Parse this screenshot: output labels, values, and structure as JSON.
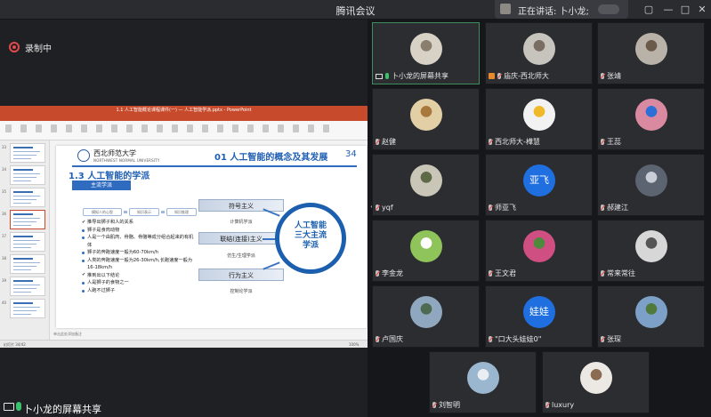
{
  "window": {
    "title": "腾讯会议",
    "speaking_label": "正在讲话: 卜小龙;",
    "controls": [
      "▢",
      "—",
      "□",
      "✕"
    ]
  },
  "recording": {
    "label": "录制中"
  },
  "share_bar": {
    "label": "卜小龙的屏幕共享"
  },
  "ppt": {
    "window_title": "1.1 人工智能概论课程课件(一) — 人工智能学派.pptx - PowerPoint",
    "ribbon_tabs": [
      "文件",
      "开始",
      "插入",
      "设计",
      "切换",
      "动画",
      "幻灯片放映",
      "审阅",
      "视图",
      "iSlide",
      "OneNote",
      "特色功能"
    ],
    "thumb_numbers": [
      "33",
      "34",
      "35",
      "36",
      "37",
      "38",
      "39",
      "40",
      "41",
      "42"
    ],
    "notes_placeholder": "单击此处添加备注",
    "status_left": "幻灯片 34/42",
    "status_right": "100%"
  },
  "slide": {
    "uni_cn": "西北师范大学",
    "uni_en": "NORTHWEST NORMAL UNIVERSITY",
    "chapter_title": "01 人工智能的概念及其发展",
    "page_number": "34",
    "section_title": "1.3 人工智能的学派",
    "section_tag": "主流学派",
    "mini_flow": [
      "模拟人的心智",
      "知识表示",
      "知识推理"
    ],
    "bullets": [
      {
        "text": "推导出狮子和人的关系",
        "type": "chk"
      },
      {
        "text": "狮子是食肉动物",
        "type": "dot"
      },
      {
        "text": "人是一个由肌肉、骨骼、骨骼等成分组合起来的有机体",
        "type": "dot"
      },
      {
        "text": "狮子的奔跑速度一般为60-70km/h",
        "type": "dot"
      },
      {
        "text": "人类的奔跑速度一般为26-30km/h,长跑速度一般为16-18km/h",
        "type": "dot"
      },
      {
        "text": "推到出以下结论",
        "type": "chk"
      },
      {
        "text": "人是狮子的食物之一",
        "type": "dot"
      },
      {
        "text": "人跑不过狮子",
        "type": "dot"
      }
    ],
    "schools": [
      {
        "name": "符号主义",
        "sub": "计算机学派"
      },
      {
        "name": "联结(连接)主义",
        "sub": "仿生/生理学派"
      },
      {
        "name": "行为主义",
        "sub": "控制论学派"
      }
    ],
    "circle_text": [
      "人工智能",
      "三大主流",
      "学派"
    ]
  },
  "participants": [
    {
      "name": "卜小龙的屏幕共享",
      "icon": "screen",
      "mic": "on",
      "avatar": "photo",
      "color": "#d8d2c6",
      "accent": "#8a7f6e",
      "active": true
    },
    {
      "name": "庙庆-西北师大",
      "icon": "host",
      "mic": "off",
      "avatar": "photo",
      "color": "#c7c3bd",
      "accent": "#7a6e62"
    },
    {
      "name": "张靖",
      "icon": "",
      "mic": "off",
      "avatar": "photo",
      "color": "#b9b2a8",
      "accent": "#6b5a4a"
    },
    {
      "name": "赵健",
      "icon": "",
      "mic": "off",
      "avatar": "photo",
      "color": "#e3cfa6",
      "accent": "#a9783c"
    },
    {
      "name": "西北师大-樺慧",
      "icon": "",
      "mic": "off",
      "avatar": "photo",
      "color": "#f2f2f2",
      "accent": "#f0b92a"
    },
    {
      "name": "王蕊",
      "icon": "",
      "mic": "off",
      "avatar": "photo",
      "color": "#d98aa0",
      "accent": "#2d6fd6"
    },
    {
      "name": "yqf",
      "icon": "",
      "mic": "off",
      "avatar": "photo",
      "color": "#c9c6b8",
      "accent": "#5d6a45"
    },
    {
      "name": "师亚飞",
      "icon": "",
      "mic": "off",
      "avatar": "text",
      "avatar_text": "亚飞",
      "color": "#1f6fe0",
      "accent": "#1f6fe0"
    },
    {
      "name": "郝建江",
      "icon": "",
      "mic": "off",
      "avatar": "photo",
      "color": "#5b6470",
      "accent": "#c9ced6"
    },
    {
      "name": "李金龙",
      "icon": "",
      "mic": "off",
      "avatar": "photo",
      "color": "#8fc45a",
      "accent": "#ffffff"
    },
    {
      "name": "王文君",
      "icon": "",
      "mic": "off",
      "avatar": "photo",
      "color": "#d04f82",
      "accent": "#4d8a3c"
    },
    {
      "name": "常来常往",
      "icon": "",
      "mic": "off",
      "avatar": "photo",
      "color": "#d7d7d7",
      "accent": "#555555"
    },
    {
      "name": "卢国庆",
      "icon": "",
      "mic": "off",
      "avatar": "photo",
      "color": "#8fa8bf",
      "accent": "#4e6a50"
    },
    {
      "name": "\"口大头娃娃0\"",
      "icon": "",
      "mic": "off",
      "avatar": "text",
      "avatar_text": "娃娃",
      "color": "#1f6fe0",
      "accent": "#1f6fe0"
    },
    {
      "name": "张琛",
      "icon": "",
      "mic": "off",
      "avatar": "photo",
      "color": "#7da0c8",
      "accent": "#4f7a3c"
    },
    {
      "name": "刘智明",
      "icon": "",
      "mic": "off",
      "avatar": "photo",
      "color": "#9bb6cf",
      "accent": "#eaeef2"
    },
    {
      "name": "luxury",
      "icon": "",
      "mic": "off",
      "avatar": "photo",
      "color": "#ece8e4",
      "accent": "#8b6b52"
    }
  ]
}
